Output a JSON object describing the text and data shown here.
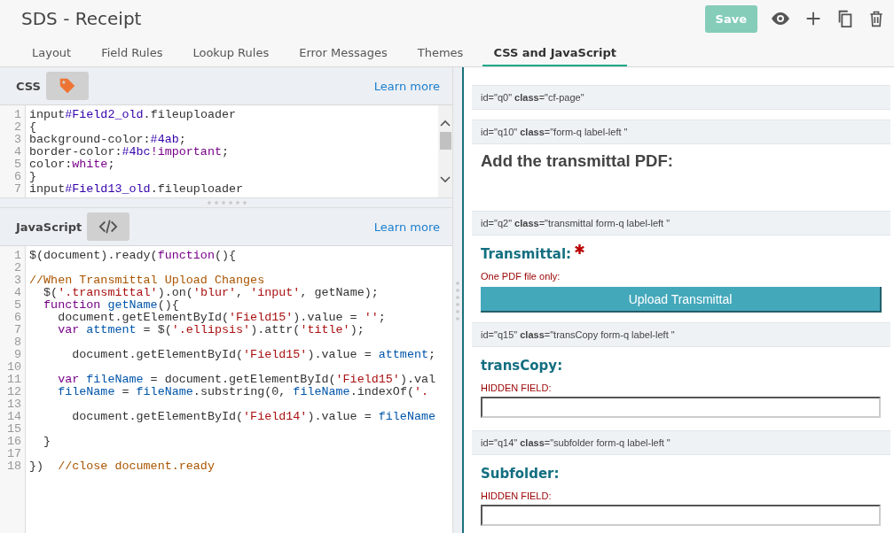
{
  "header": {
    "title": "SDS - Receipt",
    "save_button": "Save",
    "save_disabled": true
  },
  "tabs": [
    {
      "label": "Layout",
      "selected": false
    },
    {
      "label": "Field Rules",
      "selected": false
    },
    {
      "label": "Lookup Rules",
      "selected": false
    },
    {
      "label": "Error Messages",
      "selected": false
    },
    {
      "label": "Themes",
      "selected": false
    },
    {
      "label": "CSS and JavaScript",
      "selected": true
    }
  ],
  "editors": [
    {
      "kind": "css",
      "label": "CSS",
      "link": "Learn more",
      "lines": [
        {
          "number": "1",
          "tokens": [
            {
              "t": "input",
              "kind": "plain"
            },
            {
              "t": "#Field2_old",
              "kind": "id"
            },
            {
              "t": ".fileuploader",
              "kind": "plain"
            }
          ]
        },
        {
          "number": "2",
          "tokens": [
            {
              "t": "{",
              "kind": "plain"
            }
          ]
        },
        {
          "number": "3",
          "tokens": [
            {
              "t": "background-color:",
              "kind": "plain"
            },
            {
              "t": "#4ab",
              "kind": "id"
            },
            {
              "t": ";",
              "kind": "plain"
            }
          ]
        },
        {
          "number": "4",
          "tokens": [
            {
              "t": "border-color:",
              "kind": "plain"
            },
            {
              "t": "#4bc",
              "kind": "id"
            },
            {
              "t": "!important",
              "kind": "keyword"
            },
            {
              "t": ";",
              "kind": "plain"
            }
          ]
        },
        {
          "number": "5",
          "tokens": [
            {
              "t": "color:",
              "kind": "plain"
            },
            {
              "t": "white",
              "kind": "keyword"
            },
            {
              "t": ";",
              "kind": "plain"
            }
          ]
        },
        {
          "number": "6",
          "tokens": [
            {
              "t": "}",
              "kind": "plain"
            }
          ]
        },
        {
          "number": "7",
          "tokens": [
            {
              "t": "input",
              "kind": "plain"
            },
            {
              "t": "#Field13_old",
              "kind": "id"
            },
            {
              "t": ".fileuploader",
              "kind": "plain"
            }
          ]
        }
      ]
    },
    {
      "kind": "js",
      "label": "JavaScript",
      "link": "Learn more",
      "lines": [
        {
          "number": "1",
          "tokens": [
            {
              "t": "$(document).ready(",
              "kind": "plain"
            },
            {
              "t": "function",
              "kind": "keyword"
            },
            {
              "t": "(){",
              "kind": "plain"
            }
          ]
        },
        {
          "number": "2"
        },
        {
          "number": "3",
          "tokens": [
            {
              "t": "//When Transmittal Upload Changes",
              "kind": "comment"
            }
          ]
        },
        {
          "number": "4",
          "tokens": [
            {
              "t": "  $(",
              "kind": "plain"
            },
            {
              "t": "'.transmittal'",
              "kind": "string"
            },
            {
              "t": ").on(",
              "kind": "plain"
            },
            {
              "t": "'blur'",
              "kind": "string"
            },
            {
              "t": ", ",
              "kind": "plain"
            },
            {
              "t": "'input'",
              "kind": "string"
            },
            {
              "t": ", getName);",
              "kind": "plain"
            }
          ]
        },
        {
          "number": "5",
          "tokens": [
            {
              "t": "  function",
              "kind": "keyword"
            },
            {
              "t": " getName",
              "kind": "def"
            },
            {
              "t": "(){",
              "kind": "plain"
            }
          ]
        },
        {
          "number": "6",
          "tokens": [
            {
              "t": "    document.getElementById(",
              "kind": "plain"
            },
            {
              "t": "'Field15'",
              "kind": "string"
            },
            {
              "t": ").value = ",
              "kind": "plain"
            },
            {
              "t": "''",
              "kind": "string"
            },
            {
              "t": ";",
              "kind": "plain"
            }
          ]
        },
        {
          "number": "7",
          "tokens": [
            {
              "t": "    var",
              "kind": "keyword"
            },
            {
              "t": " attment",
              "kind": "def"
            },
            {
              "t": " = $(",
              "kind": "plain"
            },
            {
              "t": "'.ellipsis'",
              "kind": "string"
            },
            {
              "t": ").attr(",
              "kind": "plain"
            },
            {
              "t": "'title'",
              "kind": "string"
            },
            {
              "t": ");",
              "kind": "plain"
            }
          ]
        },
        {
          "number": "8"
        },
        {
          "number": "9",
          "tokens": [
            {
              "t": "      document.getElementById(",
              "kind": "plain"
            },
            {
              "t": "'Field15'",
              "kind": "string"
            },
            {
              "t": ").value = ",
              "kind": "plain"
            },
            {
              "t": "attment",
              "kind": "def"
            },
            {
              "t": ";",
              "kind": "plain"
            }
          ]
        },
        {
          "number": "10"
        },
        {
          "number": "11",
          "tokens": [
            {
              "t": "    var",
              "kind": "keyword"
            },
            {
              "t": " fileName",
              "kind": "def"
            },
            {
              "t": " = document.getElementById(",
              "kind": "plain"
            },
            {
              "t": "'Field15'",
              "kind": "string"
            },
            {
              "t": ").val",
              "kind": "plain"
            }
          ]
        },
        {
          "number": "12",
          "tokens": [
            {
              "t": "    fileName",
              "kind": "def"
            },
            {
              "t": " = ",
              "kind": "plain"
            },
            {
              "t": "fileName",
              "kind": "def"
            },
            {
              "t": ".substring(0, ",
              "kind": "plain"
            },
            {
              "t": "fileName",
              "kind": "def"
            },
            {
              "t": ".indexOf(",
              "kind": "plain"
            },
            {
              "t": "'.",
              "kind": "string"
            }
          ]
        },
        {
          "number": "13"
        },
        {
          "number": "14",
          "tokens": [
            {
              "t": "      document.getElementById(",
              "kind": "plain"
            },
            {
              "t": "'Field14'",
              "kind": "string"
            },
            {
              "t": ").value = ",
              "kind": "plain"
            },
            {
              "t": "fileName",
              "kind": "def"
            }
          ]
        },
        {
          "number": "15"
        },
        {
          "number": "16",
          "tokens": [
            {
              "t": "  }",
              "kind": "plain"
            }
          ]
        },
        {
          "number": "17"
        },
        {
          "number": "18",
          "tokens": [
            {
              "t": "})  ",
              "kind": "plain"
            },
            {
              "t": "//close document.ready",
              "kind": "comment"
            }
          ]
        }
      ]
    }
  ],
  "preview": [
    {
      "kind": "page",
      "band": "id=\"q0\" **class**=\"cf-page\""
    },
    {
      "kind": "heading",
      "band": "id=\"q10\" **class**=\"form-q label-left \"",
      "label": "Add the transmittal PDF:"
    },
    {
      "kind": "upload",
      "band": "id=\"q2\" **class**=\"transmittal form-q label-left \"",
      "label": "Transmittal:",
      "required": true,
      "hint": "One PDF file only:",
      "button": "Upload Transmittal"
    },
    {
      "kind": "hidden",
      "band": "id=\"q15\" **class**=\"transCopy form-q label-left \"",
      "label": "transCopy:",
      "required": false,
      "hint": "HIDDEN FIELD:"
    },
    {
      "kind": "hidden",
      "band": "id=\"q14\" **class**=\"subfolder form-q label-left \"",
      "label": "Subfolder:",
      "required": false,
      "hint": "HIDDEN FIELD:"
    }
  ]
}
